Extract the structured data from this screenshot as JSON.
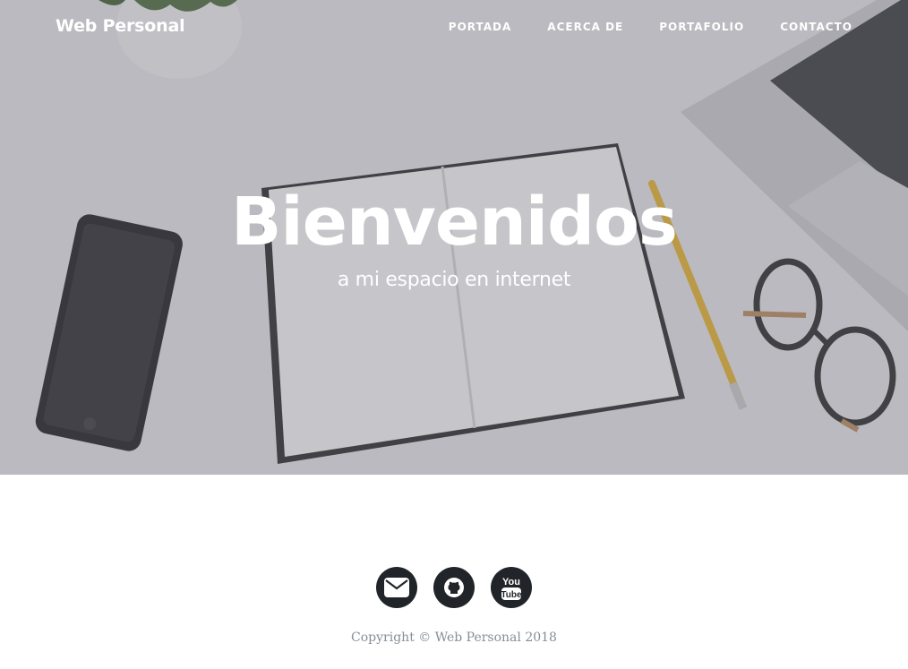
{
  "navbar": {
    "brand": "Web Personal",
    "links": [
      {
        "label": "PORTADA"
      },
      {
        "label": "ACERCA DE"
      },
      {
        "label": "PORTAFOLIO"
      },
      {
        "label": "CONTACTO"
      }
    ]
  },
  "hero": {
    "title": "Bienvenidos",
    "subtitle": "a mi espacio en internet",
    "background": "desk-photo"
  },
  "footer": {
    "social": [
      {
        "icon": "envelope-icon"
      },
      {
        "icon": "github-icon"
      },
      {
        "icon": "youtube-icon",
        "label_top": "You",
        "label_bottom": "Tube"
      }
    ],
    "copyright": "Copyright © Web Personal 2018"
  },
  "colors": {
    "footer_icon_bg": "#212529",
    "copyright_text": "#868e96",
    "hero_text": "#ffffff"
  }
}
